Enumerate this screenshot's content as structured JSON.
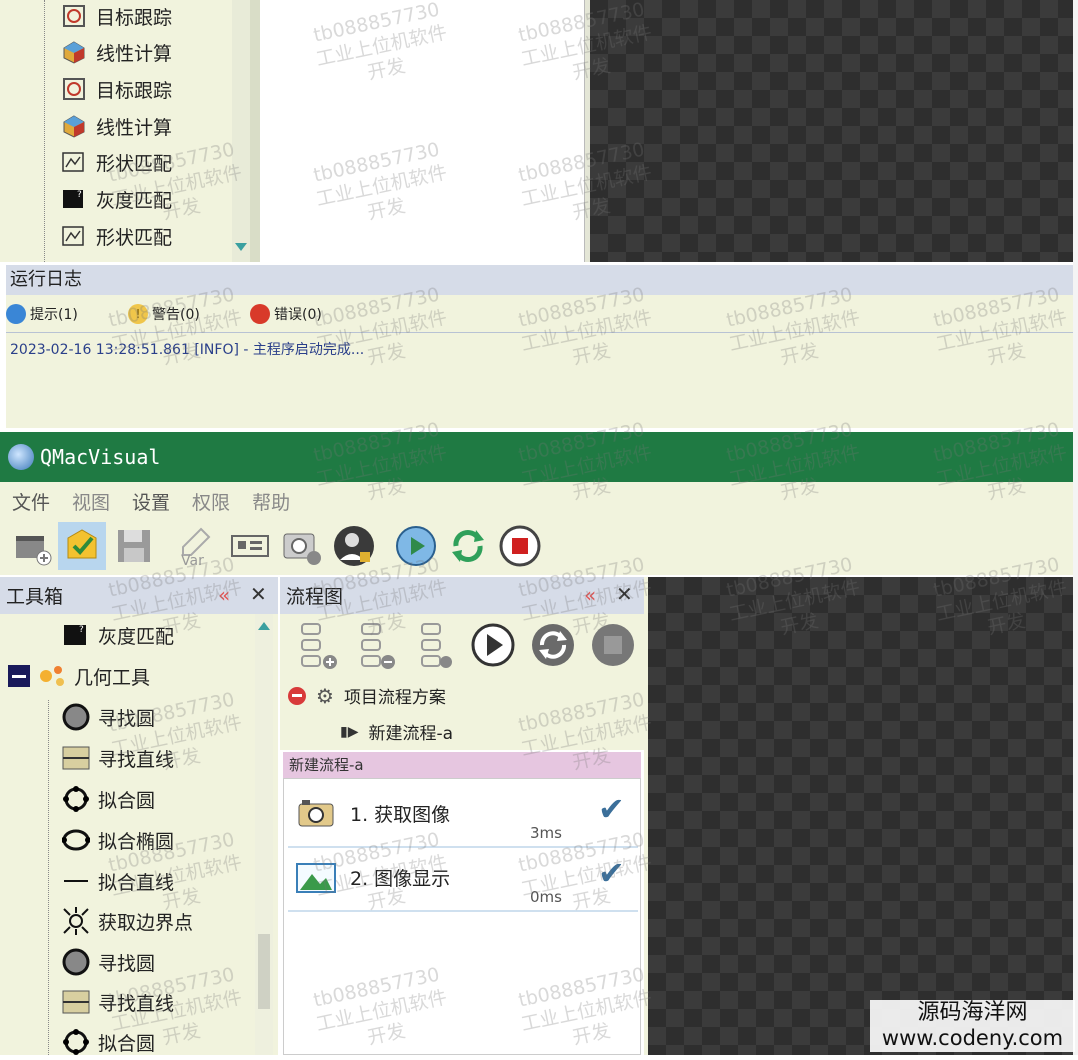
{
  "top_tree": {
    "items": [
      {
        "label": "目标跟踪",
        "icon": "target-icon"
      },
      {
        "label": "线性计算",
        "icon": "cube-icon"
      },
      {
        "label": "目标跟踪",
        "icon": "target-icon"
      },
      {
        "label": "线性计算",
        "icon": "cube-icon"
      },
      {
        "label": "形状匹配",
        "icon": "shape-match-icon"
      },
      {
        "label": "灰度匹配",
        "icon": "puzzle-icon"
      },
      {
        "label": "形状匹配",
        "icon": "shape-match-icon"
      }
    ]
  },
  "log": {
    "title": "运行日志",
    "filters": [
      {
        "label": "提示(1)",
        "icon": "info-icon",
        "color": "#3a86d6"
      },
      {
        "label": "警告(0)",
        "icon": "warning-icon",
        "color": "#f0c64a"
      },
      {
        "label": "错误(0)",
        "icon": "error-icon",
        "color": "#d83a2a"
      }
    ],
    "entries": [
      {
        "time": "2023-02-16 13:28:51.861",
        "level": "[INFO]",
        "sep": "-",
        "message": "主程序启动完成..."
      }
    ]
  },
  "app": {
    "title": "QMacVisual",
    "titlebar_color": "#1f7a43",
    "menu": [
      "文件",
      "视图",
      "设置",
      "权限",
      "帮助"
    ]
  },
  "toolbar_icons": [
    "new-project-icon",
    "open-folder-icon",
    "save-icon",
    "variable-icon",
    "camera-card-icon",
    "camera-settings-icon",
    "user-lock-icon",
    "run-once-icon",
    "loop-run-icon",
    "stop-icon"
  ],
  "toolbox": {
    "title": "工具箱",
    "items": [
      {
        "label": "灰度匹配",
        "icon": "puzzle-icon"
      },
      {
        "label": "几何工具",
        "icon": "geometry-group-icon",
        "group": true
      },
      {
        "label": "寻找圆",
        "icon": "circle-icon"
      },
      {
        "label": "寻找直线",
        "icon": "line-box-icon"
      },
      {
        "label": "拟合圆",
        "icon": "fit-circle-icon"
      },
      {
        "label": "拟合椭圆",
        "icon": "fit-ellipse-icon"
      },
      {
        "label": "拟合直线",
        "icon": "fit-line-icon"
      },
      {
        "label": "获取边界点",
        "icon": "edge-points-icon"
      },
      {
        "label": "寻找圆",
        "icon": "circle-icon"
      },
      {
        "label": "寻找直线",
        "icon": "line-box-icon"
      },
      {
        "label": "拟合圆",
        "icon": "fit-circle-icon"
      }
    ]
  },
  "flow": {
    "title": "流程图",
    "project": "项目流程方案",
    "process": "新建流程-a",
    "active_tab": "新建流程-a",
    "steps": [
      {
        "label": "1. 获取图像",
        "time": "3ms",
        "icon": "camera-icon"
      },
      {
        "label": "2. 图像显示",
        "time": "0ms",
        "icon": "image-icon"
      }
    ]
  },
  "watermark": {
    "line1": "tb088857730",
    "line2": "工业上位机软件",
    "line3": "开发"
  },
  "corner_watermark": {
    "line1": "源码海洋网",
    "line2": "www.codeny.com"
  }
}
